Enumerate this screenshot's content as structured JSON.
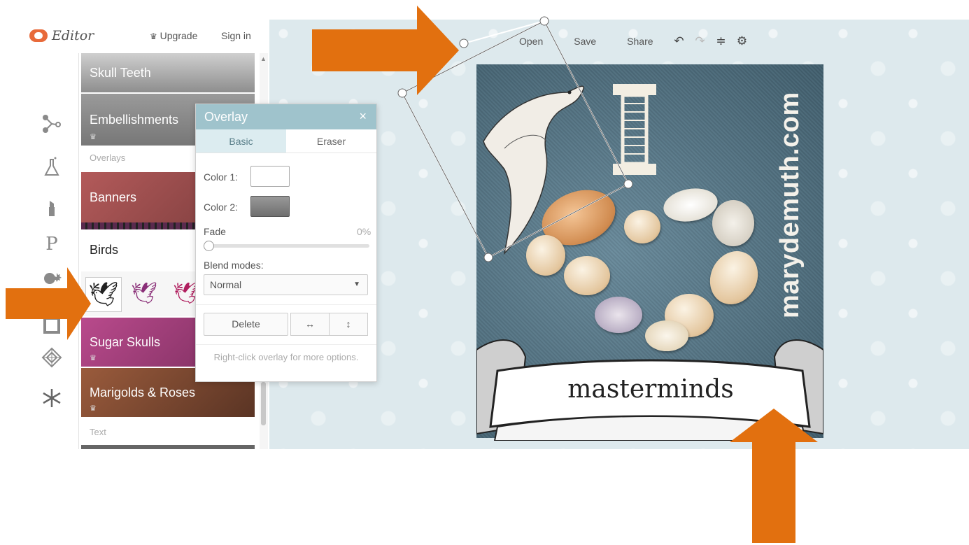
{
  "header": {
    "app_name": "Editor",
    "upgrade_label": "Upgrade",
    "signin_label": "Sign in"
  },
  "toolbar": {
    "open_label": "Open",
    "save_label": "Save",
    "share_label": "Share",
    "icons": [
      "undo-icon",
      "redo-icon",
      "layers-icon",
      "settings-icon"
    ]
  },
  "library": {
    "tiles": [
      {
        "label": "Skull Teeth"
      },
      {
        "label": "Embellishments",
        "crown": "♛"
      },
      {
        "section": "Overlays"
      },
      {
        "label": "Banners"
      },
      {
        "label": "Birds"
      },
      {
        "label": "Sugar Skulls",
        "crown": "♛"
      },
      {
        "label": "Marigolds & Roses",
        "crown": "♛"
      },
      {
        "section": "Text"
      }
    ]
  },
  "overlay_panel": {
    "title": "Overlay",
    "close": "×",
    "tabs": [
      "Basic",
      "Eraser"
    ],
    "active_tab": "Basic",
    "color1_label": "Color 1:",
    "color1_value": "#ffffff",
    "color2_label": "Color 2:",
    "color2_value": "#8a8a8a",
    "fade_label": "Fade",
    "fade_value": "0%",
    "fade_fraction": 0,
    "blend_label": "Blend modes:",
    "blend_value": "Normal",
    "delete_label": "Delete",
    "flip_h_label": "↔",
    "flip_v_label": "↕",
    "hint": "Right-click overlay for more options."
  },
  "photo": {
    "site_text": "marydemuth.com",
    "letter": "I",
    "banner_text": "masterminds"
  },
  "colors": {
    "accent_orange": "#e2700f",
    "panel_header": "#9fc3cc"
  }
}
